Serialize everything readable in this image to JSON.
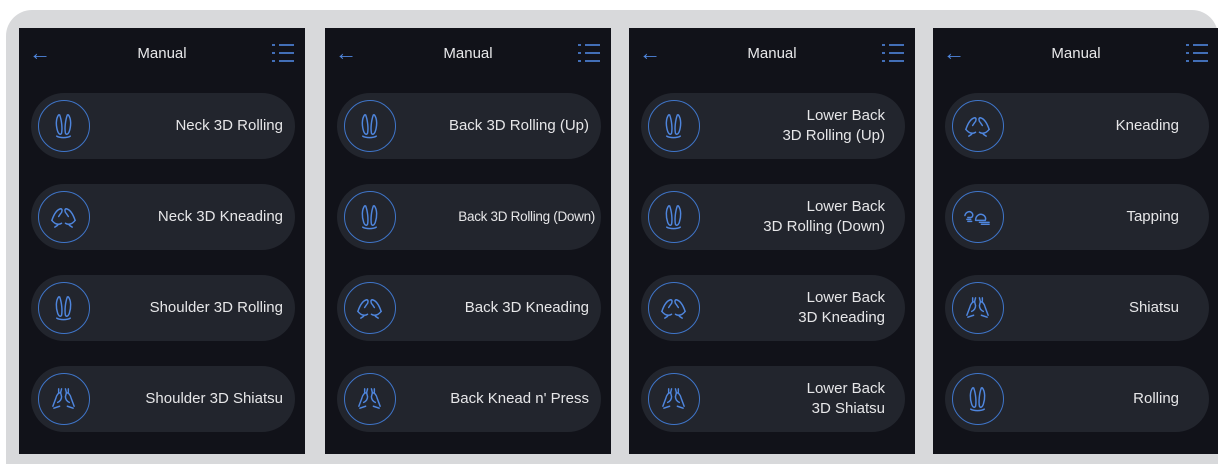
{
  "screens": [
    {
      "title": "Manual",
      "items": [
        {
          "line1": "Neck 3D Rolling",
          "line2": "",
          "icon": "rolling-icon"
        },
        {
          "line1": "Neck 3D Kneading",
          "line2": "",
          "icon": "kneading-icon"
        },
        {
          "line1": "Shoulder 3D Rolling",
          "line2": "",
          "icon": "rolling-icon"
        },
        {
          "line1": "Shoulder 3D Shiatsu",
          "line2": "",
          "icon": "shiatsu-icon"
        }
      ]
    },
    {
      "title": "Manual",
      "items": [
        {
          "line1": "Back 3D Rolling (Up)",
          "line2": "",
          "icon": "rolling-icon"
        },
        {
          "line1": "Back 3D Rolling (Down)",
          "line2": "",
          "icon": "rolling-icon"
        },
        {
          "line1": "Back 3D Kneading",
          "line2": "",
          "icon": "kneading-icon"
        },
        {
          "line1": "Back Knead n' Press",
          "line2": "",
          "icon": "shiatsu-icon"
        }
      ]
    },
    {
      "title": "Manual",
      "items": [
        {
          "line1": "Lower Back",
          "line2": "3D Rolling (Up)",
          "icon": "rolling-icon"
        },
        {
          "line1": "Lower Back",
          "line2": "3D Rolling (Down)",
          "icon": "rolling-icon"
        },
        {
          "line1": "Lower Back",
          "line2": "3D Kneading",
          "icon": "kneading-icon"
        },
        {
          "line1": "Lower Back",
          "line2": "3D Shiatsu",
          "icon": "shiatsu-icon"
        }
      ]
    },
    {
      "title": "Manual",
      "items": [
        {
          "line1": "Kneading",
          "line2": "",
          "icon": "kneading-icon"
        },
        {
          "line1": "Tapping",
          "line2": "",
          "icon": "tapping-icon"
        },
        {
          "line1": "Shiatsu",
          "line2": "",
          "icon": "shiatsu-icon"
        },
        {
          "line1": "Rolling",
          "line2": "",
          "icon": "rolling-icon"
        }
      ]
    }
  ],
  "colors": {
    "accent": "#3f75c9",
    "panel": "#111219",
    "button": "#22252d",
    "text": "#e6e6e8"
  }
}
